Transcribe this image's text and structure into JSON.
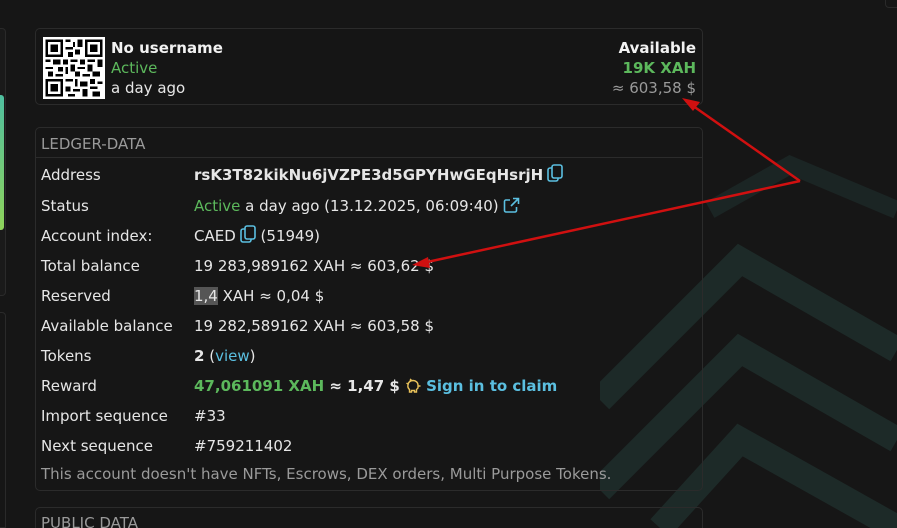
{
  "account": {
    "username": "No username",
    "status": "Active",
    "activated_ago": "a day ago",
    "available_label": "Available",
    "available_amount": "19K XAH",
    "available_usd": "≈ 603,58 $"
  },
  "ledger": {
    "title": "LEDGER-DATA",
    "rows": {
      "address": {
        "label": "Address",
        "value": "rsK3T82kikNu6jVZPE3d5GPYHwGEqHsrjH"
      },
      "status": {
        "label": "Status",
        "value_status": "Active",
        "value_rest": " a day ago (13.12.2025, 06:09:40)"
      },
      "account_index": {
        "label": "Account index:",
        "value": "CAED",
        "value_num": "(51949)"
      },
      "total_balance": {
        "label": "Total balance",
        "value": "19 283,989162 XAH ≈ 603,62 $"
      },
      "reserved": {
        "label": "Reserved",
        "value_hl": "1,4",
        "value_rest": " XAH ≈ 0,04 $"
      },
      "available_balance": {
        "label": "Available balance",
        "value": "19 282,589162 XAH ≈ 603,58 $"
      },
      "tokens": {
        "label": "Tokens",
        "count": "2",
        "open": " (",
        "link": "view",
        "close": ")"
      },
      "reward": {
        "label": "Reward",
        "amount": "47,061091 XAH",
        "usd": " ≈ 1,47 $ ",
        "link": "Sign in to claim"
      },
      "import_sequence": {
        "label": "Import sequence",
        "value": "#33"
      },
      "next_sequence": {
        "label": "Next sequence",
        "value": "#759211402"
      }
    },
    "note": "This account doesn't have NFTs, Escrows, DEX orders, Multi Purpose Tokens."
  },
  "public": {
    "title": "PUBLIC DATA"
  },
  "icons": {
    "copy": "copy-icon",
    "external": "external-link-icon",
    "piggy": "piggy-bank-icon",
    "qr": "qr-code-icon"
  },
  "colors": {
    "background": "#161616",
    "green": "#5cb85c",
    "link": "#5bbfe0",
    "muted": "#9a9a9a",
    "arrow": "#d01010"
  }
}
